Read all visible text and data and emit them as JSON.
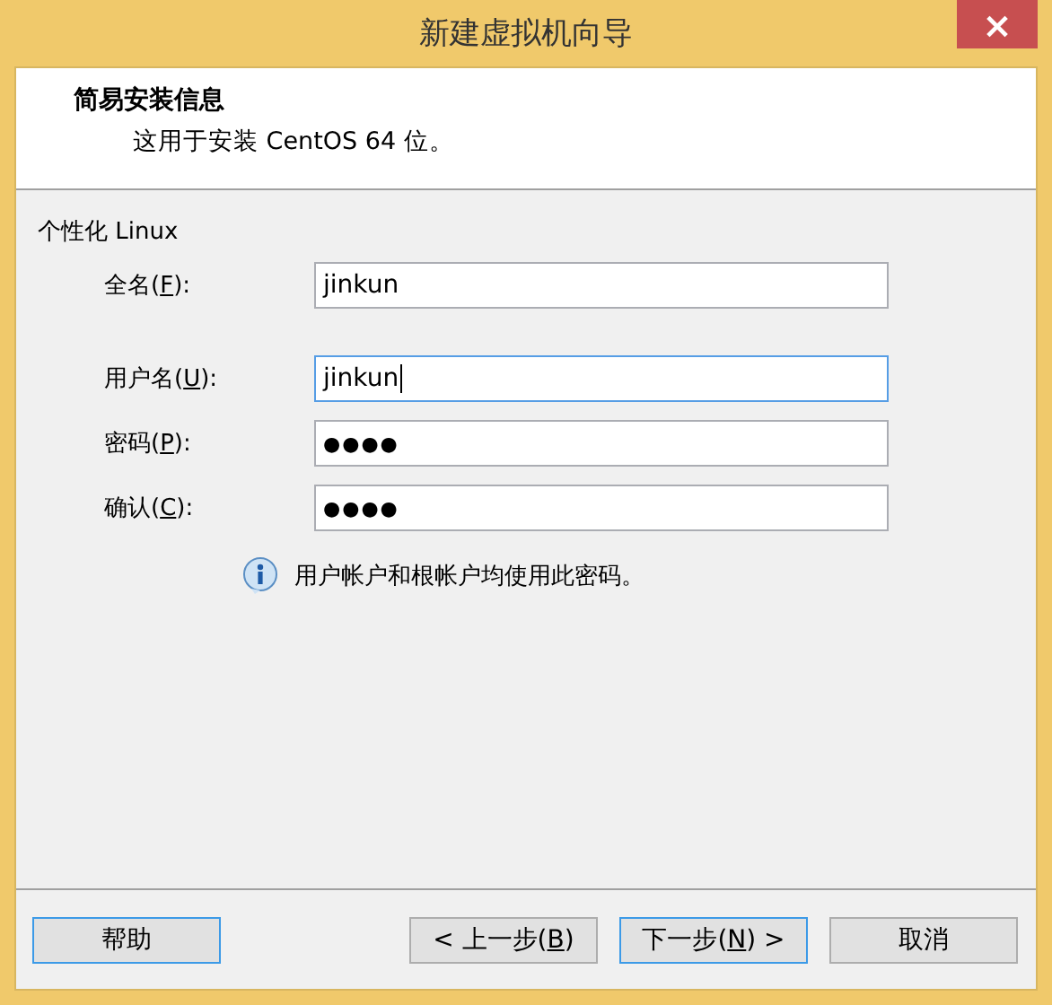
{
  "window": {
    "title": "新建虚拟机向导",
    "close": "×"
  },
  "header": {
    "title": "简易安装信息",
    "subtitle": "这用于安装 CentOS 64 位。"
  },
  "group": {
    "title": "个性化 Linux"
  },
  "fields": [
    {
      "label": "全名(",
      "mnemonic": "F",
      "label_end": "):",
      "value": "jinkun",
      "kind": "text",
      "focused": false
    },
    {
      "label": "用户名(",
      "mnemonic": "U",
      "label_end": "):",
      "value": "jinkun",
      "kind": "text",
      "focused": true
    },
    {
      "label": "密码(",
      "mnemonic": "P",
      "label_end": "):",
      "value": "●●●●",
      "kind": "password",
      "focused": false
    },
    {
      "label": "确认(",
      "mnemonic": "C",
      "label_end": "):",
      "value": "●●●●",
      "kind": "password",
      "focused": false
    }
  ],
  "info": "用户帐户和根帐户均使用此密码。",
  "buttons": [
    {
      "label": "帮助",
      "default": true
    },
    {
      "label": "< 上一步(",
      "mnemonic": "B",
      "label_end": ")",
      "default": false
    },
    {
      "label": "下一步(",
      "mnemonic": "N",
      "label_end": ") >",
      "default": true
    },
    {
      "label": "取消",
      "default": false
    }
  ]
}
